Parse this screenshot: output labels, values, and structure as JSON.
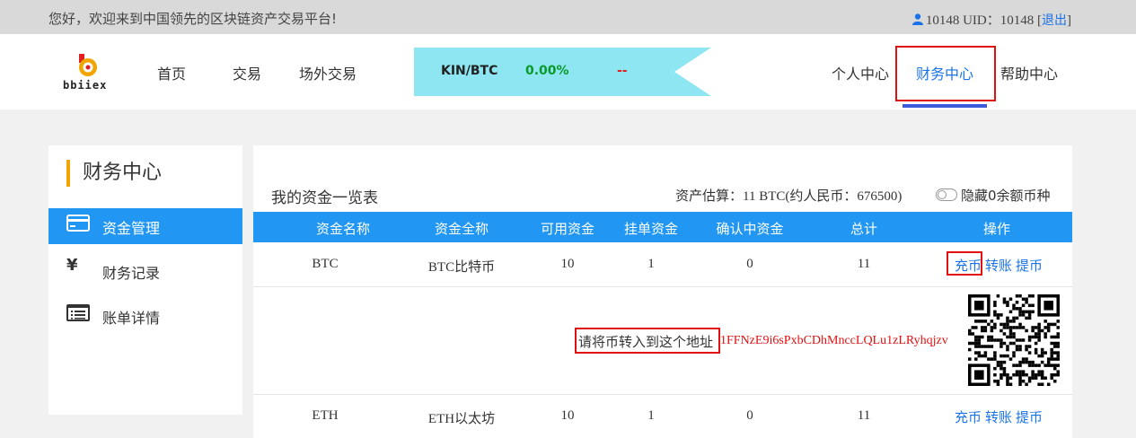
{
  "topbar": {
    "welcome": "您好，欢迎来到中国领先的区块链资产交易平台!",
    "user_id": "10148 UID：10148",
    "logout": "退出"
  },
  "logo": {
    "text": "bbiiex",
    "icon": "logo-mark"
  },
  "nav": {
    "home": "首页",
    "trade": "交易",
    "otc": "场外交易"
  },
  "ticker": {
    "pair": "KIN/BTC",
    "change": "0.00%",
    "price": "--"
  },
  "right_nav": {
    "personal": "个人中心",
    "finance": "财务中心",
    "help": "帮助中心"
  },
  "sidebar": {
    "title": "财务中心",
    "items": [
      {
        "label": "资金管理",
        "icon": "card-icon",
        "active": true
      },
      {
        "label": "财务记录",
        "icon": "yen-icon",
        "active": false
      },
      {
        "label": "账单详情",
        "icon": "list-icon",
        "active": false
      }
    ]
  },
  "main": {
    "title": "我的资金一览表",
    "estimate_label": "资产估算：",
    "estimate_value": "11 BTC(约人民币：676500)",
    "hide_label": "隐藏0余额币种",
    "columns": [
      "资金名称",
      "资金全称",
      "可用资金",
      "挂单资金",
      "确认中资金",
      "总计",
      "操作"
    ],
    "rows": [
      {
        "name": "BTC",
        "fullname": "BTC比特币",
        "available": "10",
        "orders": "1",
        "confirming": "0",
        "total": "11",
        "ops": {
          "deposit": "充币",
          "transfer": "转账",
          "withdraw": "提币"
        }
      },
      {
        "name": "ETH",
        "fullname": "ETH以太坊",
        "available": "10",
        "orders": "1",
        "confirming": "0",
        "total": "11",
        "ops": {
          "deposit": "充币",
          "transfer": "转账",
          "withdraw": "提币"
        }
      }
    ],
    "deposit": {
      "prompt": "请将币转入到这个地址",
      "address": "1FFNzE9i6sPxbCDhMnccLQLu1zLRyhqjzv"
    }
  },
  "colors": {
    "accent": "#2196f3",
    "highlight": "#e01010",
    "positive": "#0a9a2a",
    "title_bar": "#f0a500"
  }
}
